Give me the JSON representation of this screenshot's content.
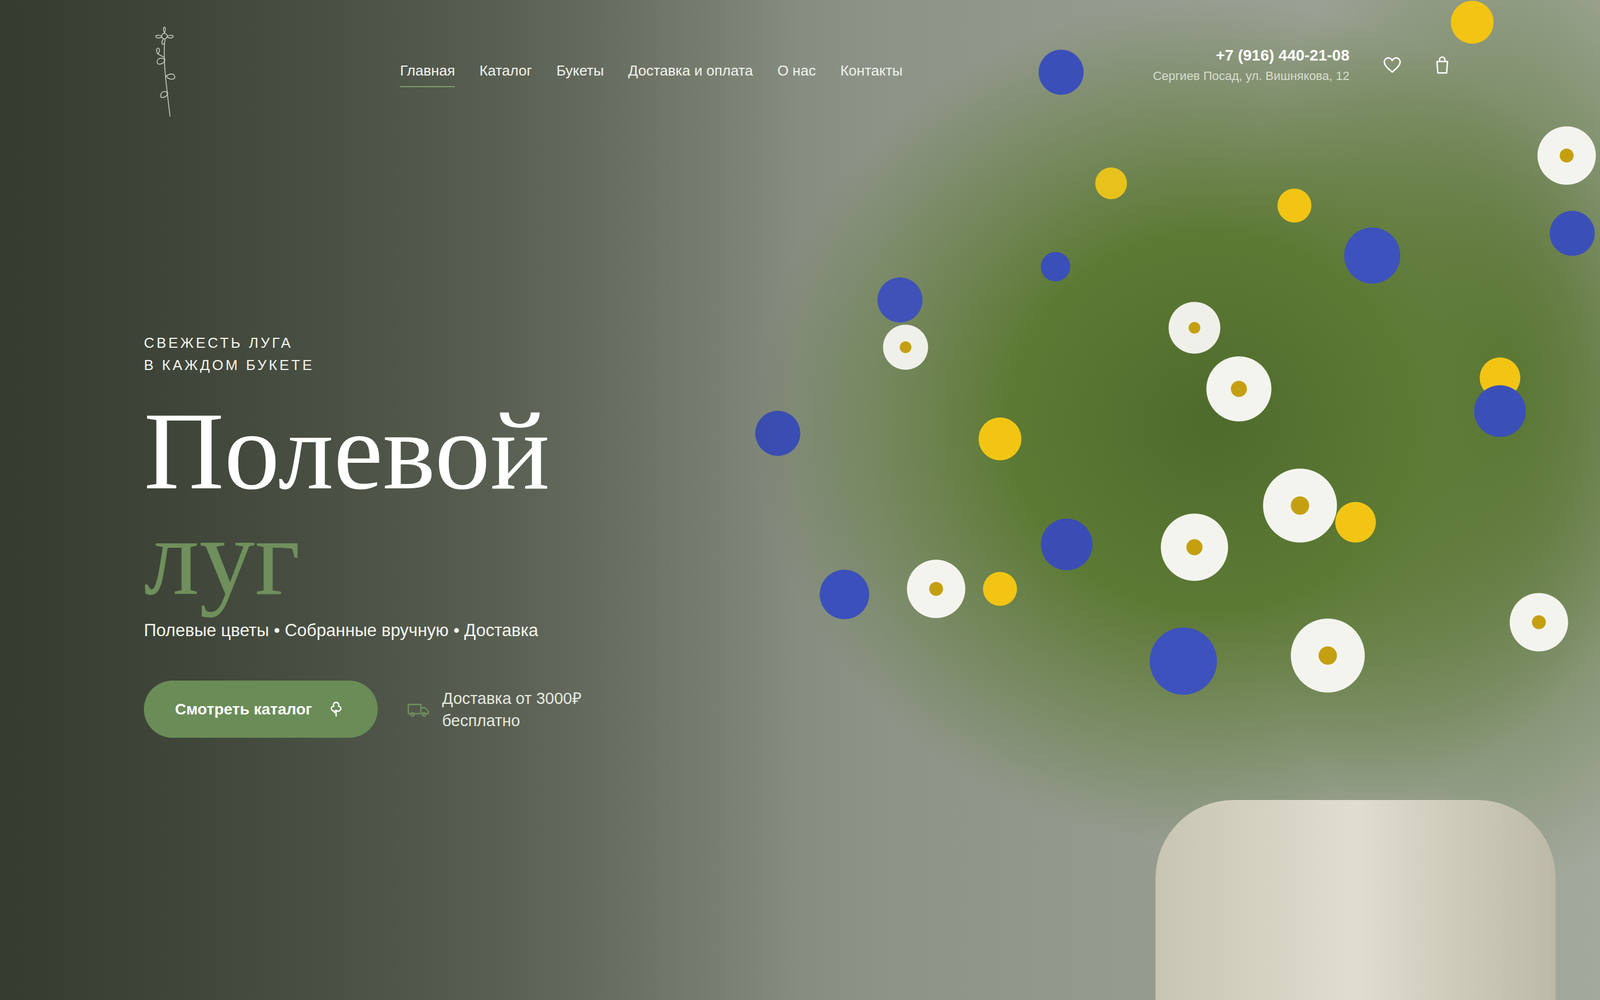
{
  "header": {
    "nav": [
      {
        "label": "Главная",
        "selected": true
      },
      {
        "label": "Каталог",
        "selected": false
      },
      {
        "label": "Букеты",
        "selected": false
      },
      {
        "label": "Доставка и оплата",
        "selected": false
      },
      {
        "label": "О нас",
        "selected": false
      },
      {
        "label": "Контакты",
        "selected": false
      }
    ],
    "phone": "+7 (916) 440-21-08",
    "address": "Сергиев Посад, ул. Вишнякова, 12"
  },
  "hero": {
    "eyebrow": [
      "СВЕЖЕСТЬ ЛУГА",
      "В КАЖДОМ БУКЕТЕ"
    ],
    "title": "Полевой",
    "accent": "луг",
    "subtitle": "Полевые цветы • Собранные вручную • Доставка",
    "button": "Смотреть каталог",
    "delivery_note": [
      "Доставка от 3000₽",
      "бесплатно"
    ]
  }
}
